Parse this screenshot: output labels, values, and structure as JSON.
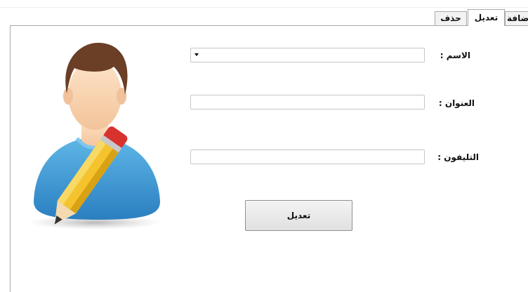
{
  "tabs": {
    "delete_label": "حذف",
    "edit_label": "تعديل",
    "add_label": "إضافة"
  },
  "form": {
    "name_label": "الاسم :",
    "address_label": "العنوان :",
    "phone_label": "التليفون :",
    "name_value": "",
    "address_value": "",
    "phone_value": "",
    "submit_label": "تعديل"
  },
  "icons": {
    "avatar": "user-edit-icon",
    "dropdown": "dropdown-arrow-icon"
  }
}
